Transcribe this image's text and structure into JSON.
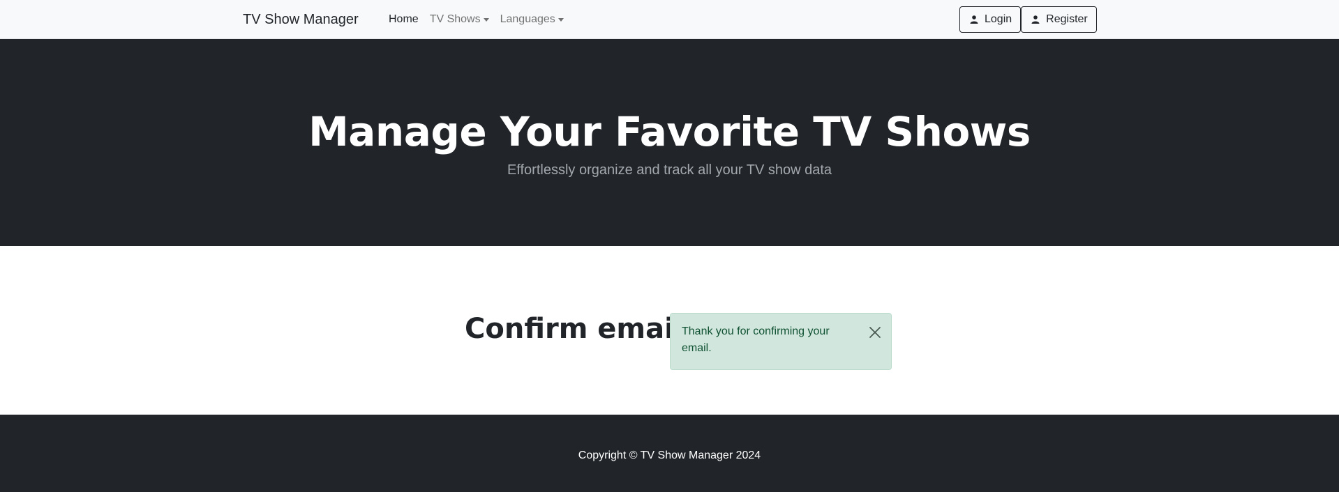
{
  "navbar": {
    "brand": "TV Show Manager",
    "links": [
      {
        "label": "Home",
        "active": true
      },
      {
        "label": "TV Shows",
        "dropdown": true
      },
      {
        "label": "Languages",
        "dropdown": true
      }
    ],
    "login_label": "Login",
    "register_label": "Register"
  },
  "hero": {
    "title": "Manage Your Favorite TV Shows",
    "subtitle": "Effortlessly organize and track all your TV show data"
  },
  "main": {
    "title": "Confirm email",
    "alert_text": "Thank you for confirming your email."
  },
  "footer": {
    "copyright": "Copyright © TV Show Manager 2024"
  },
  "colors": {
    "dark": "#212529",
    "navbar_bg": "#f8f9fa",
    "alert_bg": "#d1e7dd",
    "alert_text": "#0f5132"
  },
  "icons": {
    "user": "user-icon",
    "close": "close-icon",
    "caret": "caret-down-icon"
  }
}
